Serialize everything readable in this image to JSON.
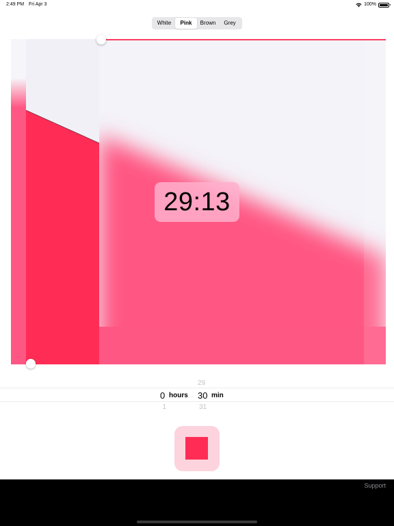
{
  "status_bar": {
    "time": "2:49 PM",
    "date": "Fri Apr 3",
    "battery": "100%"
  },
  "noise_color": {
    "options": [
      "White",
      "Pink",
      "Brown",
      "Grey"
    ],
    "selected": "Pink"
  },
  "timer": {
    "remaining": "29:13"
  },
  "duration_picker": {
    "hours": {
      "above": "",
      "selected": "0",
      "below": "1",
      "unit": "hours"
    },
    "minutes": {
      "above": "29",
      "selected": "30",
      "below": "31",
      "unit": "min"
    }
  },
  "footer": {
    "support_label": "Support"
  },
  "colors": {
    "accent": "#ff2d55",
    "noise_fill": "#ff5783",
    "background_light": "#f3f2f8",
    "stop_button_bg": "#fdd3dd"
  }
}
